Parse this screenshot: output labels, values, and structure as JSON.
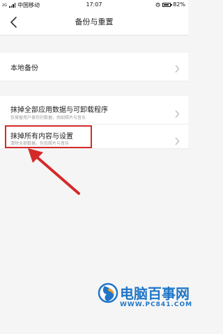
{
  "status_bar": {
    "signal_label": "2G",
    "carrier": "中国移动",
    "time": "17:07",
    "battery_text": "82%",
    "battery_level": 0.82
  },
  "header": {
    "back_icon": "chevron-left-icon",
    "title": "备份与重置"
  },
  "settings": [
    {
      "title": "本地备份",
      "subtitle": ""
    },
    {
      "title": "抹掉全部应用数据与可卸载程序",
      "subtitle": "仅保留用户保存的数据，例如照片与音乐"
    },
    {
      "title": "抹掉所有内容与设置",
      "subtitle": "清除全部数据，包括照片与音乐"
    }
  ],
  "annotation": {
    "color": "#d42a2a"
  },
  "watermark": {
    "title": "电脑百事网",
    "url": "WWW.PC841.COM",
    "color": "#1f76c8"
  }
}
